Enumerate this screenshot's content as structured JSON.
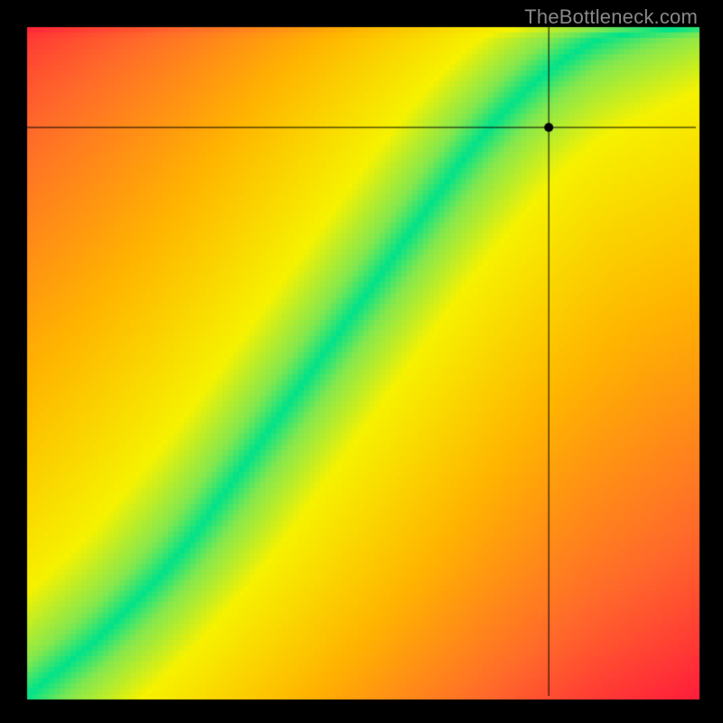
{
  "watermark": "TheBottleneck.com",
  "chart_data": {
    "type": "heatmap",
    "title": "",
    "xlabel": "",
    "ylabel": "",
    "xlim": [
      0,
      1
    ],
    "ylim": [
      0,
      1
    ],
    "canvas_size": 800,
    "plot_offset": 30,
    "plot_size": 740,
    "crosshair": {
      "x": 0.78,
      "y": 0.85
    },
    "marker": {
      "x": 0.78,
      "y": 0.85,
      "radius": 5,
      "color": "#000000"
    },
    "optimal_curve_points": [
      {
        "x": 0.0,
        "y": 0.0
      },
      {
        "x": 0.05,
        "y": 0.04
      },
      {
        "x": 0.1,
        "y": 0.08
      },
      {
        "x": 0.15,
        "y": 0.13
      },
      {
        "x": 0.2,
        "y": 0.18
      },
      {
        "x": 0.25,
        "y": 0.24
      },
      {
        "x": 0.3,
        "y": 0.31
      },
      {
        "x": 0.35,
        "y": 0.38
      },
      {
        "x": 0.4,
        "y": 0.45
      },
      {
        "x": 0.45,
        "y": 0.52
      },
      {
        "x": 0.5,
        "y": 0.59
      },
      {
        "x": 0.55,
        "y": 0.66
      },
      {
        "x": 0.6,
        "y": 0.73
      },
      {
        "x": 0.65,
        "y": 0.8
      },
      {
        "x": 0.7,
        "y": 0.86
      },
      {
        "x": 0.75,
        "y": 0.91
      },
      {
        "x": 0.8,
        "y": 0.95
      },
      {
        "x": 0.85,
        "y": 0.98
      },
      {
        "x": 0.9,
        "y": 0.99
      },
      {
        "x": 1.0,
        "y": 1.0
      }
    ],
    "band_half_width": 0.05,
    "color_scale": [
      {
        "t": 0.0,
        "color": "#00e28a"
      },
      {
        "t": 0.08,
        "color": "#8ae84a"
      },
      {
        "t": 0.18,
        "color": "#f6f200"
      },
      {
        "t": 0.45,
        "color": "#ffb400"
      },
      {
        "t": 0.75,
        "color": "#ff6a2a"
      },
      {
        "t": 1.0,
        "color": "#ff1f3a"
      }
    ],
    "pixelation": 6,
    "crosshair_color": "#000000",
    "crosshair_width": 1
  }
}
